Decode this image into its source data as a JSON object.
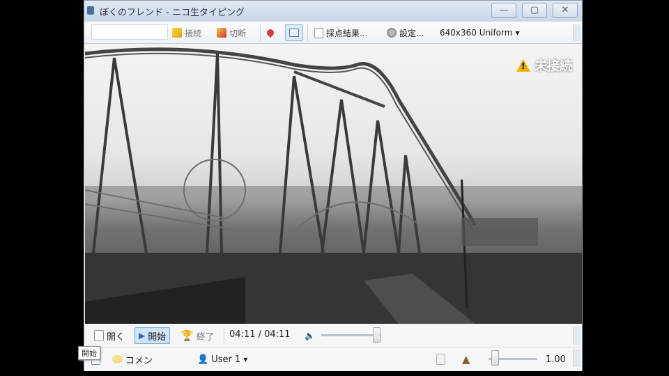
{
  "window": {
    "title": "ぼくのフレンド - ニコ生タイピング",
    "minimize": "—",
    "maximize": "▢",
    "close": "✕"
  },
  "toolbar": {
    "connect": "接続",
    "disconnect": "切断",
    "score_results": "採点結果...",
    "settings": "設定...",
    "resolution": "640x360 Uniform"
  },
  "video": {
    "status": "未接続"
  },
  "controls": {
    "open": "開く",
    "start": "開始",
    "end": "終了",
    "time": "04:11 / 04:11",
    "progress": 1.0
  },
  "bottom": {
    "comment": "コメン",
    "user": "User 1",
    "speed": "1.00"
  },
  "tooltip": "開始",
  "colors": {
    "accent": "#cfe3f8",
    "warning": "#f0b400",
    "titlebar": "#c9d7e8"
  }
}
